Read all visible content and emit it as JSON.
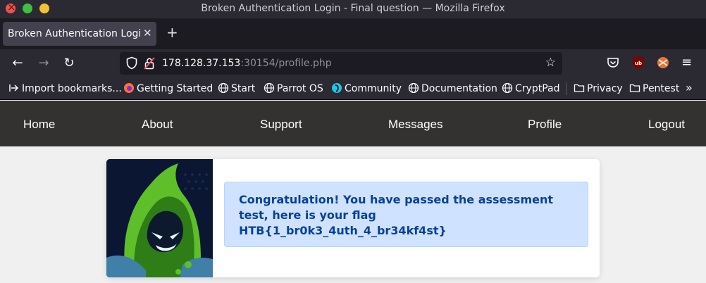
{
  "window": {
    "title": "Broken Authentication Login - Final question — Mozilla Firefox"
  },
  "tabs": [
    {
      "label": "Broken Authentication Login"
    }
  ],
  "address_bar": {
    "host": "178.128.37.153",
    "path": ":30154/profile.php"
  },
  "bookmarks": [
    {
      "label": "Import bookmarks...",
      "icon": "import-icon"
    },
    {
      "label": "Getting Started",
      "icon": "firefox-icon"
    },
    {
      "label": "Start",
      "icon": "globe-icon"
    },
    {
      "label": "Parrot OS",
      "icon": "globe-icon"
    },
    {
      "label": "Community",
      "icon": "parrot-icon"
    },
    {
      "label": "Documentation",
      "icon": "globe-icon"
    },
    {
      "label": "CryptPad",
      "icon": "globe-icon"
    },
    {
      "label": "Privacy",
      "icon": "folder-icon"
    },
    {
      "label": "Pentest",
      "icon": "folder-icon"
    }
  ],
  "site_nav": {
    "items": [
      "Home",
      "About",
      "Support",
      "Messages",
      "Profile",
      "Logout"
    ]
  },
  "alert": {
    "message": "Congratulation! You have passed the assessment test, here is your flag",
    "flag": "HTB{1_br0k3_4uth_4_br34kf4st}"
  },
  "colors": {
    "browser_chrome": "#2b2a33",
    "site_nav_bg": "#333230",
    "alert_bg": "#cfe2ff",
    "alert_text": "#084298"
  }
}
